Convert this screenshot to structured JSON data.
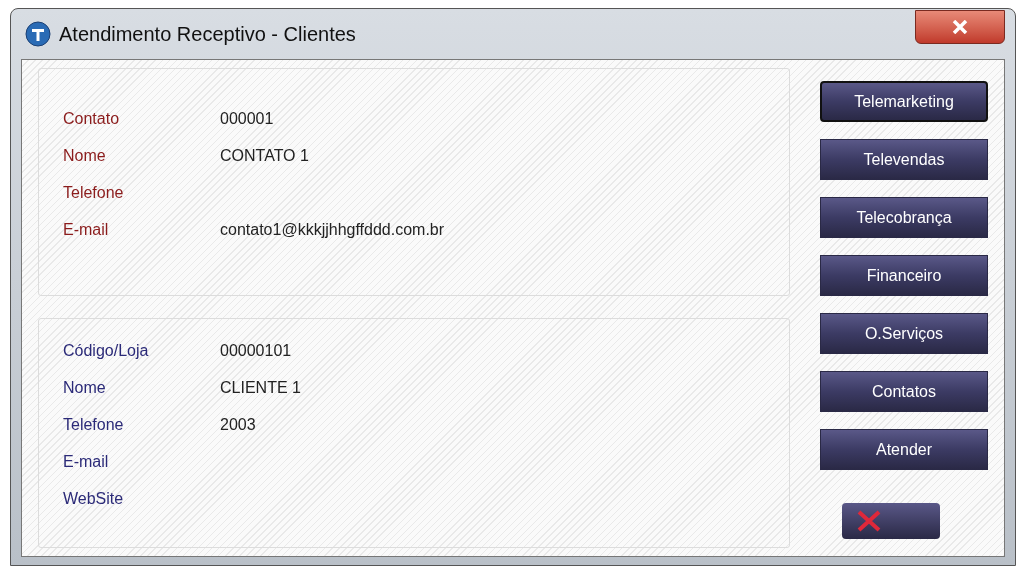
{
  "window": {
    "title": "Atendimento Receptivo - Clientes"
  },
  "sections": [
    {
      "kind": "contact",
      "fields": [
        {
          "label": "Contato",
          "value": "000001"
        },
        {
          "label": "Nome",
          "value": "CONTATO 1"
        },
        {
          "label": "Telefone"
        },
        {
          "label": "E-mail",
          "value": "contato1@kkkjjhhgffddd.com.br"
        }
      ]
    },
    {
      "kind": "client",
      "fields": [
        {
          "label": "Código/Loja",
          "value": "00000101"
        },
        {
          "label": "Nome",
          "value": "CLIENTE 1"
        },
        {
          "label": "Telefone",
          "value": "2003"
        },
        {
          "label": "E-mail"
        },
        {
          "label": "WebSite"
        }
      ]
    }
  ],
  "buttons": [
    {
      "label": "Telemarketing",
      "focused": true
    },
    {
      "label": "Televendas",
      "focused": false
    },
    {
      "label": "Telecobrança",
      "focused": false
    },
    {
      "label": "Financeiro",
      "focused": false
    },
    {
      "label": "O.Serviços",
      "focused": false
    },
    {
      "label": "Contatos",
      "focused": false
    },
    {
      "label": "Atender",
      "focused": false
    }
  ]
}
